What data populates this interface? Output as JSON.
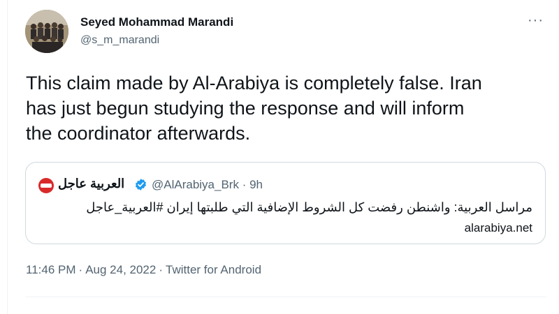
{
  "tweet": {
    "author_name": "Seyed Mohammad Marandi",
    "author_handle": "@s_m_marandi",
    "more_label": "···",
    "text": "This claim made by Al-Arabiya is completely false. Iran\nhas just begun studying the response and will inform\nthe coordinator afterwards.",
    "time": "11:46 PM",
    "date": "Aug 24, 2022",
    "sep": "·",
    "source": "Twitter for Android"
  },
  "quoted": {
    "author_name": "العربية عاجل",
    "author_handle": "@AlArabiya_Brk · 9h",
    "text": "مراسل العربية: واشنطن رفضت كل الشروط الإضافية التي طلبتها إيران #العربية_عاجل",
    "link": "alarabiya.net"
  },
  "colors": {
    "text_primary": "#0f1419",
    "text_secondary": "#536471",
    "border": "#cfd9de",
    "verified": "#1d9bf0",
    "quoted_logo": "#d92a2a"
  },
  "icons": {
    "more": "more-horizontal-icon",
    "verified": "verified-badge-icon",
    "quoted_logo": "al-arabiya-logo-icon"
  }
}
